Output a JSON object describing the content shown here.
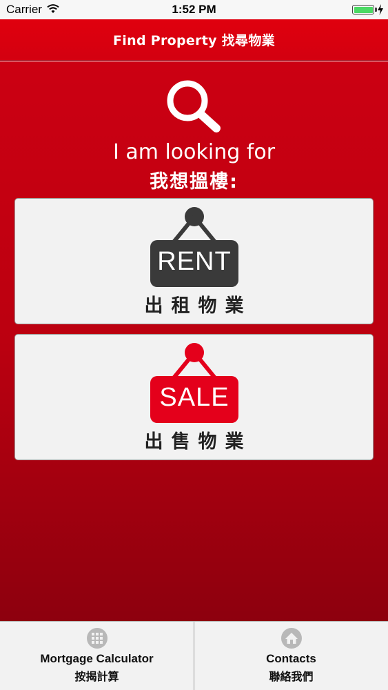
{
  "status_bar": {
    "carrier": "Carrier",
    "time": "1:52 PM",
    "battery_color": "#4cd964"
  },
  "nav": {
    "title": "Find Property 找尋物業",
    "background_color": "#d8000f"
  },
  "main": {
    "icon": "search-icon",
    "heading_en": "I am looking for",
    "heading_zh": "我想搵樓:",
    "options": [
      {
        "sign_text": "RENT",
        "caption": "出租物業",
        "sign_color": "#3a3a3a",
        "icon": "hanging-sign-icon"
      },
      {
        "sign_text": "SALE",
        "caption": "出售物業",
        "sign_color": "#e4001b",
        "icon": "hanging-sign-icon"
      }
    ]
  },
  "tabs": [
    {
      "label_en": "Mortgage Calculator",
      "label_zh": "按揭計算",
      "icon": "calculator-icon"
    },
    {
      "label_en": "Contacts",
      "label_zh": "聯絡我們",
      "icon": "home-icon"
    }
  ]
}
